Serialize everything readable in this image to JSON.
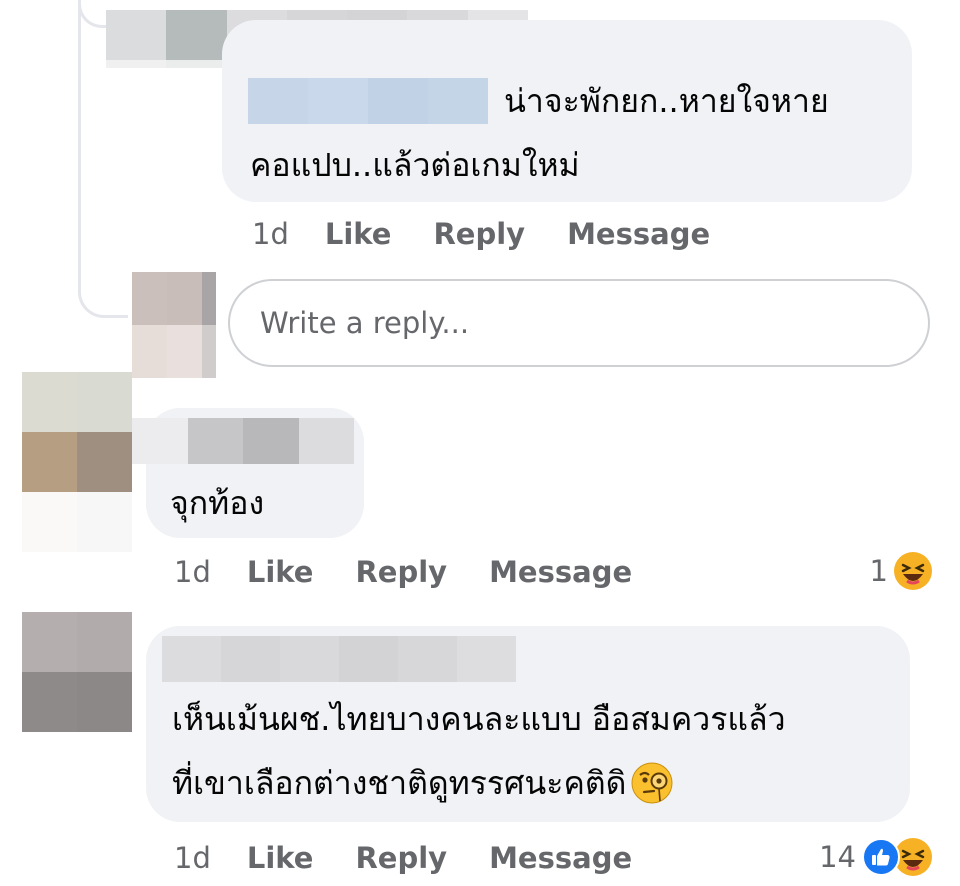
{
  "comments": [
    {
      "id": "reply-1",
      "text_line_1": "น่าจะพักยก..หายใจหาย",
      "text_line_2": "คอแปบ..แล้วต่อเกมใหม่",
      "time": "1d",
      "like_label": "Like",
      "reply_label": "Reply",
      "message_label": "Message"
    },
    {
      "id": "comment-2",
      "text_line_1": "จุกท้อง",
      "time": "1d",
      "like_label": "Like",
      "reply_label": "Reply",
      "message_label": "Message",
      "reaction_count": "1",
      "reaction_icons": [
        "haha-icon"
      ]
    },
    {
      "id": "comment-3",
      "text_line_1": "เห็นเม้นผช.ไทยบางคนละแบบ อือสมควรแล้ว",
      "text_line_2": "ที่เขาเลือกต่างชาติดูทรรศนะคติดิ",
      "inline_emoji": "monocle-face-icon",
      "time": "1d",
      "like_label": "Like",
      "reply_label": "Reply",
      "message_label": "Message",
      "reaction_count": "14",
      "reaction_icons": [
        "like-icon",
        "haha-icon"
      ]
    }
  ],
  "reply_box": {
    "placeholder": "Write a reply..."
  },
  "colors": {
    "bubble_bg": "#f0f2f5",
    "secondary_text": "#65676b",
    "like_blue": "#1877f2",
    "haha_yellow": "#f7b125"
  }
}
